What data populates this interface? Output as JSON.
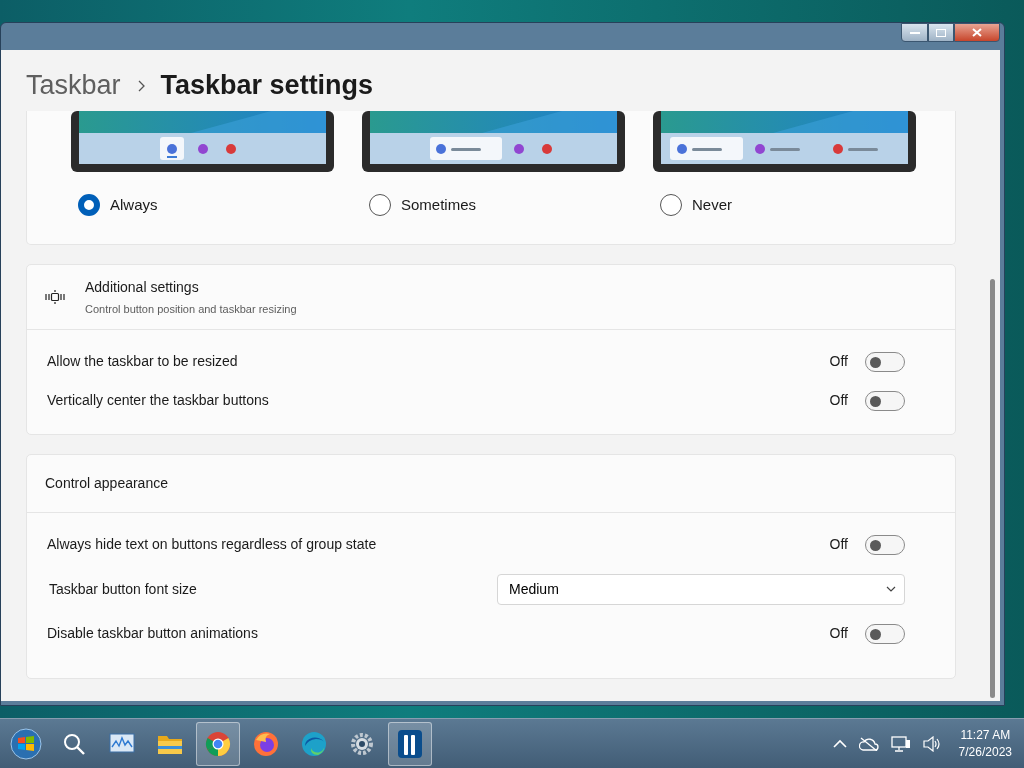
{
  "breadcrumb": [
    {
      "label": "Taskbar"
    },
    {
      "label": "Taskbar settings"
    }
  ],
  "combine_options": [
    {
      "label": "Always",
      "selected": true,
      "kind": "icons"
    },
    {
      "label": "Sometimes",
      "selected": false,
      "kind": "first-label"
    },
    {
      "label": "Never",
      "selected": false,
      "kind": "all-labels"
    }
  ],
  "sections": [
    {
      "title": "Additional settings",
      "subtitle": "Control button position and taskbar resizing",
      "settings": [
        {
          "kind": "toggle",
          "label": "Allow the taskbar to be resized",
          "state_text": "Off",
          "on": false
        },
        {
          "kind": "toggle",
          "label": "Vertically center the taskbar buttons",
          "state_text": "Off",
          "on": false
        }
      ]
    },
    {
      "title": "Control appearance",
      "settings": [
        {
          "kind": "toggle",
          "label": "Always hide text on buttons regardless of group state",
          "state_text": "Off",
          "on": false
        },
        {
          "kind": "dropdown",
          "label": "Taskbar button font size",
          "value": "Medium"
        },
        {
          "kind": "toggle",
          "label": "Disable taskbar button animations",
          "state_text": "Off",
          "on": false
        }
      ]
    }
  ],
  "taskbar": {
    "apps": [
      {
        "kind": "start",
        "selected": false
      },
      {
        "kind": "search",
        "selected": false
      },
      {
        "kind": "monitor",
        "selected": false
      },
      {
        "kind": "folder",
        "selected": false
      },
      {
        "kind": "chrome",
        "selected": true
      },
      {
        "kind": "firefox",
        "selected": false
      },
      {
        "kind": "edge",
        "selected": false
      },
      {
        "kind": "gear",
        "selected": false
      },
      {
        "kind": "app",
        "selected": true
      }
    ],
    "clock": {
      "time": "11:27 AM",
      "date": "7/26/2023"
    }
  }
}
